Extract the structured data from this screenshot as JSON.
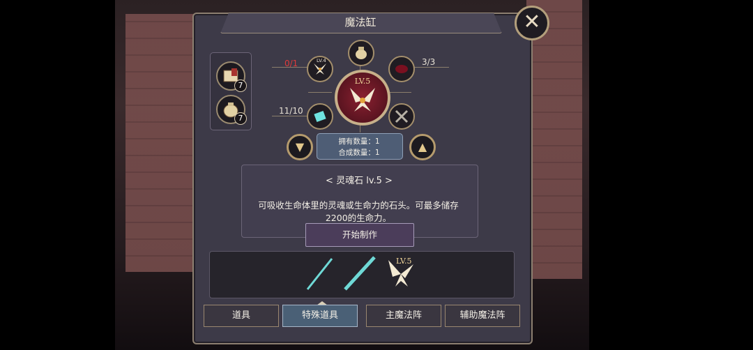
{
  "window": {
    "title": "魔法缸"
  },
  "close_button": {
    "label": "✕"
  },
  "inventory": {
    "items": [
      {
        "name": "book-item",
        "count": "7"
      },
      {
        "name": "pouch-item",
        "count": "7"
      }
    ]
  },
  "recipe": {
    "center_level": "LV.5",
    "ingredients": {
      "top_left": {
        "ratio": "0/1",
        "level": "LV.4"
      },
      "top_right": {
        "ratio": "3/3"
      },
      "bottom_left": {
        "ratio": "11/10"
      }
    },
    "owned_label": "拥有数量：1",
    "craft_label": "合成数量：1"
  },
  "description": {
    "title": "< 灵魂石 lv.5 >",
    "text": "可吸收生命体里的灵魂或生命力的石头。可最多储存2200的生命力。"
  },
  "craft_button": {
    "label": "开始制作"
  },
  "result_slot": {
    "level": "LV.5"
  },
  "tabs": [
    {
      "label": "道具"
    },
    {
      "label": "特殊道具",
      "active": true
    },
    {
      "label": "主魔法阵"
    },
    {
      "label": "辅助魔法阵"
    }
  ],
  "colors": {
    "accent": "#c7b08a",
    "active_tab": "#4a6076",
    "warning": "#e03a3a"
  }
}
